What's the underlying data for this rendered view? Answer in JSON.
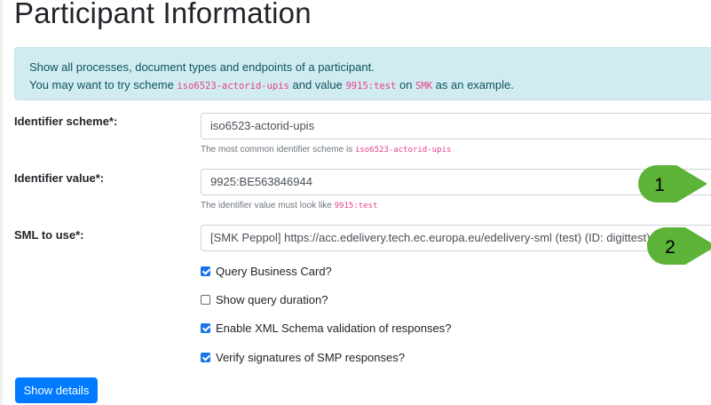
{
  "page": {
    "title": "Participant Information"
  },
  "info": {
    "line1": "Show all processes, document types and endpoints of a participant.",
    "line2_prefix": "You may want to try scheme ",
    "line2_scheme": "iso6523-actorid-upis",
    "line2_mid": " and value ",
    "line2_value": "9915:test",
    "line2_on": " on ",
    "line2_sml": "SMK",
    "line2_suffix": " as an example."
  },
  "form": {
    "scheme": {
      "label": "Identifier scheme*:",
      "value": "iso6523-actorid-upis",
      "help_prefix": "The most common identifier scheme is ",
      "help_code": "iso6523-actorid-upis"
    },
    "value": {
      "label": "Identifier value*:",
      "value": "9925:BE563846944",
      "help_prefix": "The identifier value must look like ",
      "help_code": "9915:test"
    },
    "sml": {
      "label": "SML to use*:",
      "selected": "[SMK Peppol] https://acc.edelivery.tech.ec.europa.eu/edelivery-sml (test) (ID: digittest)"
    },
    "checkboxes": [
      {
        "label": "Query Business Card?",
        "checked": true
      },
      {
        "label": "Show query duration?",
        "checked": false
      },
      {
        "label": "Enable XML Schema validation of responses?",
        "checked": true
      },
      {
        "label": "Verify signatures of SMP responses?",
        "checked": true
      }
    ],
    "submit_label": "Show details"
  },
  "annotations": [
    {
      "number": "1",
      "color": "#5cb338"
    },
    {
      "number": "2",
      "color": "#5cb338"
    }
  ]
}
